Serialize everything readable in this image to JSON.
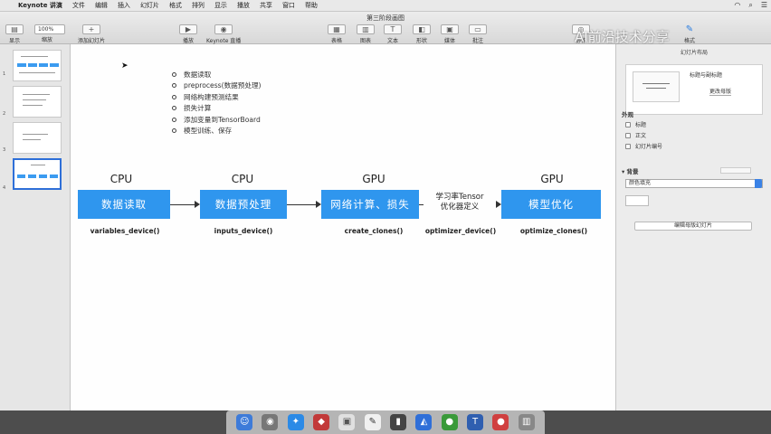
{
  "menubar": {
    "items": [
      "Keynote 讲演",
      "文件",
      "编辑",
      "插入",
      "幻灯片",
      "格式",
      "排列",
      "显示",
      "播放",
      "共享",
      "窗口",
      "帮助"
    ]
  },
  "toolbar": {
    "doc_title": "第三阶段画图",
    "zoom": "100%",
    "buttons": {
      "display": "显示",
      "zoom": "缩放",
      "add_slide": "添加幻灯片",
      "play": "播放",
      "keynote_live": "Keynote 直播",
      "table": "表格",
      "chart": "图表",
      "text": "文本",
      "shape": "形状",
      "media": "媒体",
      "comment": "批注",
      "collaborate": "协作",
      "format": "格式"
    },
    "watermark": "AI前沿技术分享"
  },
  "slides": {
    "numbers": [
      "1",
      "2",
      "3",
      "4"
    ]
  },
  "slide": {
    "bullets": [
      "数据读取",
      "preprocess(数据预处理)",
      "网络构建预测结果",
      "损失计算",
      "添加变量到TensorBoard",
      "模型训练、保存"
    ],
    "stages": [
      {
        "device": "CPU",
        "label": "数据读取",
        "func": "variables_device()"
      },
      {
        "device": "CPU",
        "label": "数据预处理",
        "func": "inputs_device()"
      },
      {
        "device": "GPU",
        "label": "网络计算、损失",
        "func": "create_clones()"
      },
      {
        "device": "GPU",
        "label": "模型优化",
        "func": "optimize_clones()"
      }
    ],
    "arrow_label_line1": "学习率Tensor",
    "arrow_label_line2": "优化器定义",
    "arrow_func": "optimizer_device()"
  },
  "right_panel": {
    "tab": "幻灯片布局",
    "master_name": "标题与副标题",
    "change_master": "更改母版",
    "appearance": "外观",
    "checks": [
      "标题",
      "正文",
      "幻灯片编号"
    ],
    "background": "背景",
    "fill": "颜色填充",
    "edit_master": "编辑母版幻灯片"
  }
}
